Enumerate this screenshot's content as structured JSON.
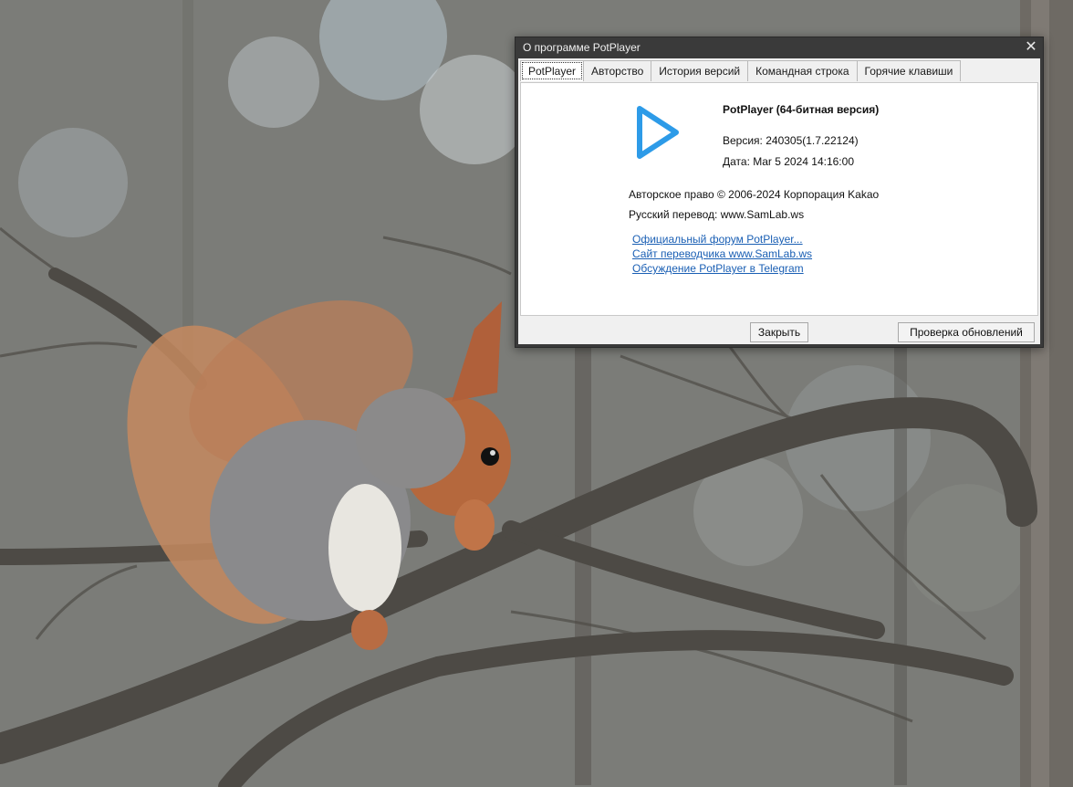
{
  "window": {
    "title": "О программе PotPlayer",
    "close_glyph": "✕"
  },
  "tabs": [
    {
      "label": "PotPlayer",
      "active": true
    },
    {
      "label": "Авторство",
      "active": false
    },
    {
      "label": "История версий",
      "active": false
    },
    {
      "label": "Командная строка",
      "active": false
    },
    {
      "label": "Горячие клавиши",
      "active": false
    }
  ],
  "about": {
    "product_name": "PotPlayer (64-битная версия)",
    "version": "Версия: 240305(1.7.22124)",
    "date": "Дата: Mar  5 2024 14:16:00",
    "copyright": "Авторское право © 2006-2024 Корпорация Kakao",
    "translation": "Русский перевод: www.SamLab.ws"
  },
  "links": [
    "Официальный форум PotPlayer...",
    "Сайт переводчика www.SamLab.ws",
    "Обсуждение PotPlayer в Telegram"
  ],
  "buttons": {
    "close_label": "Закрыть",
    "check_updates_label": "Проверка обновлений"
  },
  "icons": {
    "app_logo": "play-triangle-icon",
    "logo_color": "#2d9be8"
  },
  "colors": {
    "link": "#1a5fb4",
    "titlebar": "#3a3a3a"
  }
}
